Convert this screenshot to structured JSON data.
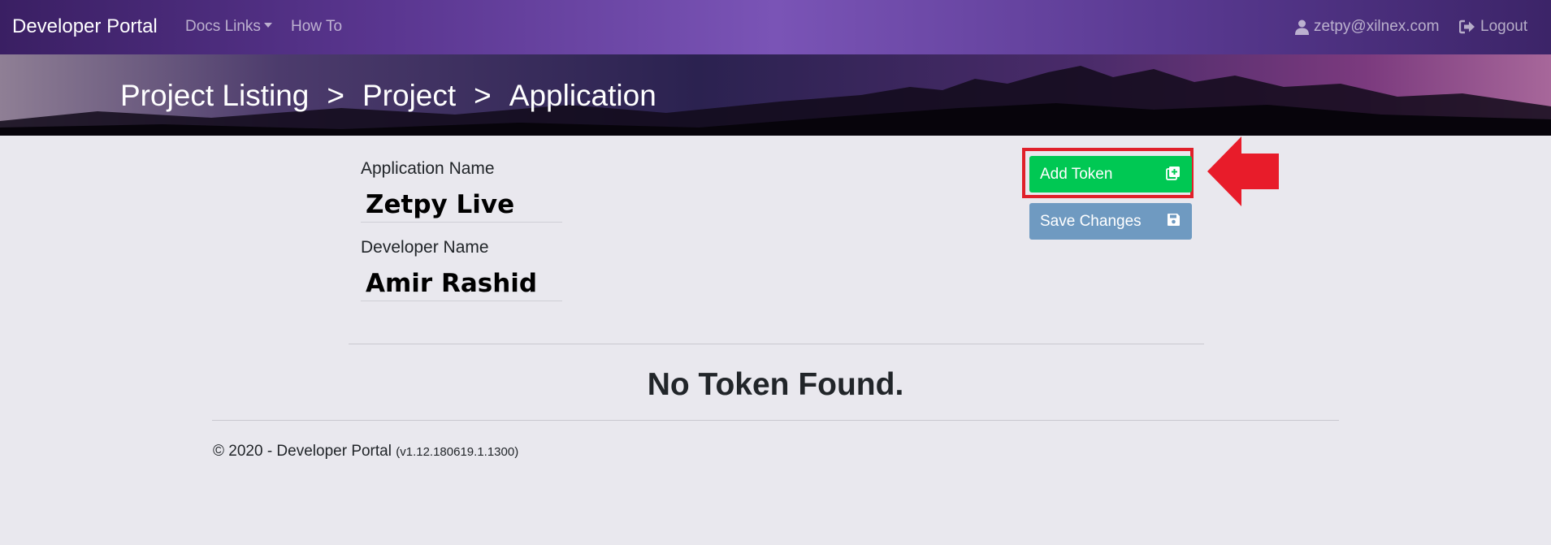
{
  "navbar": {
    "brand": "Developer Portal",
    "docs_links": "Docs Links",
    "how_to": "How To",
    "user_email": "zetpy@xilnex.com",
    "logout": "Logout"
  },
  "breadcrumb": {
    "items": [
      "Project Listing",
      "Project",
      "Application"
    ],
    "separator": ">"
  },
  "form": {
    "application_name_label": "Application Name",
    "application_name_value": "Zetpy Live",
    "developer_name_label": "Developer Name",
    "developer_name_value": "Amir Rashid"
  },
  "actions": {
    "add_token_label": "Add Token",
    "save_changes_label": "Save Changes"
  },
  "tokens": {
    "empty_message": "No Token Found."
  },
  "footer": {
    "copyright": "© 2020 - Developer Portal",
    "version": "(v1.12.180619.1.1300)"
  },
  "colors": {
    "add_token_button": "#00c853",
    "save_changes_button": "#6f9ac1",
    "highlight": "#e0202a",
    "page_background": "#e9e8ee"
  },
  "icons": {
    "user": "user-icon",
    "logout": "sign-out-icon",
    "add_token": "plus-square-icon",
    "save": "floppy-disk-icon",
    "annotation": "red-arrow-left"
  }
}
